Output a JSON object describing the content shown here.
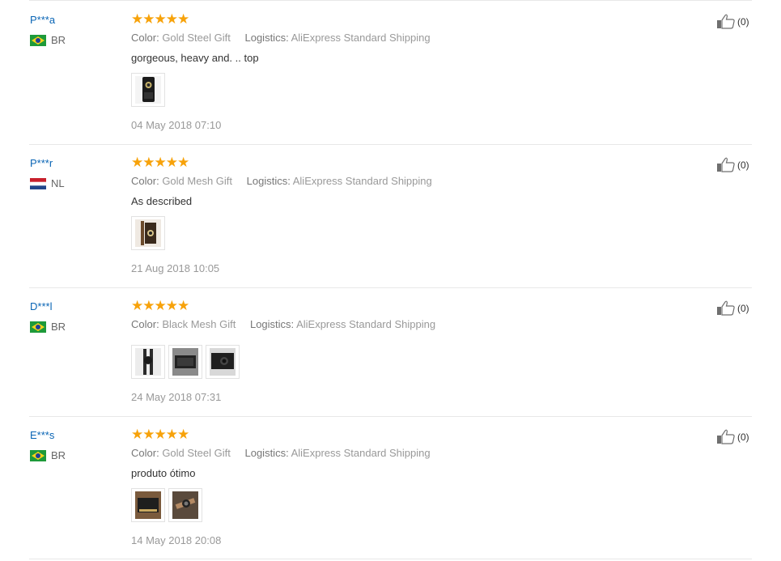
{
  "reviews": [
    {
      "user": "P***a",
      "country": "BR",
      "flag": "br",
      "stars": 5,
      "color_label": "Color:",
      "color_value": "Gold Steel Gift",
      "logistics_label": "Logistics:",
      "logistics_value": "AliExpress Standard Shipping",
      "text": "gorgeous, heavy and. .. top",
      "date": "04 May 2018 07:10",
      "helpful": "(0)",
      "images": [
        "watch-box-photo"
      ]
    },
    {
      "user": "P***r",
      "country": "NL",
      "flag": "nl",
      "stars": 5,
      "color_label": "Color:",
      "color_value": "Gold Mesh Gift",
      "logistics_label": "Logistics:",
      "logistics_value": "AliExpress Standard Shipping",
      "text": "As described",
      "date": "21 Aug 2018 10:05",
      "helpful": "(0)",
      "images": [
        "watch-photo"
      ]
    },
    {
      "user": "D***l",
      "country": "BR",
      "flag": "br",
      "stars": 5,
      "color_label": "Color:",
      "color_value": "Black Mesh Gift",
      "logistics_label": "Logistics:",
      "logistics_value": "AliExpress Standard Shipping",
      "text": "",
      "date": "24 May 2018 07:31",
      "helpful": "(0)",
      "images": [
        "watch-photo",
        "box-photo",
        "watch-in-box-photo"
      ]
    },
    {
      "user": "E***s",
      "country": "BR",
      "flag": "br",
      "stars": 5,
      "color_label": "Color:",
      "color_value": "Gold Steel Gift",
      "logistics_label": "Logistics:",
      "logistics_value": "AliExpress Standard Shipping",
      "text": "produto ótimo",
      "date": "14 May 2018 20:08",
      "helpful": "(0)",
      "images": [
        "box-photo",
        "watch-in-hand-photo"
      ]
    }
  ],
  "colors": {
    "star": "#f7a20a",
    "user_link": "#0a65b5",
    "meta_text": "#999999"
  }
}
